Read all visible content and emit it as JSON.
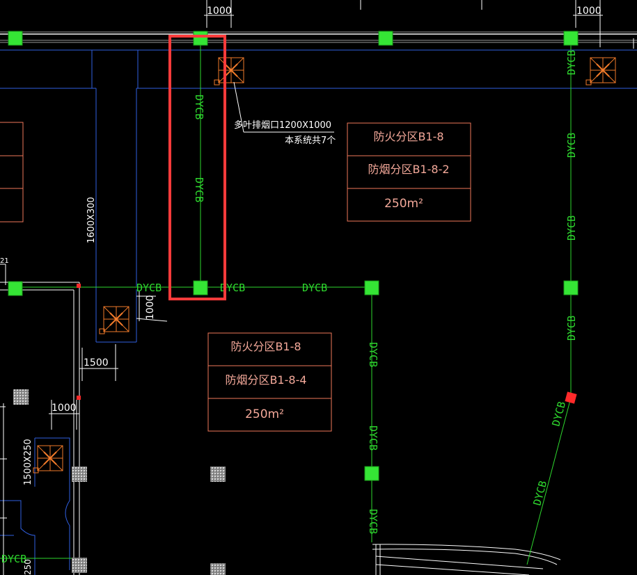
{
  "colors": {
    "background": "#000000",
    "duct_line": "#2ed82e",
    "node_fill": "#35e535",
    "duct_blue": "#2f5fe0",
    "zone_box": "#f0785a",
    "dimension": "#ffffff",
    "highlight": "#ff3b3b",
    "gray_node": "#bdbdbd"
  },
  "duct_tag": "DYCB",
  "dimensions": {
    "top_left": "1000",
    "top_right": "1000",
    "vertical_1000": "1000",
    "w1500": "1500",
    "w1000_lower": "1000",
    "duct_1600x300": "1600X300",
    "duct_1500x250": "1500X250",
    "left_partial": "21",
    "bottom_left_partial": "250"
  },
  "smoke_outlet_note": {
    "line1": "多叶排烟口1200X1000",
    "line2": "本系统共7个"
  },
  "zone_boxes": [
    {
      "fire_zone": "防火分区B1-8",
      "smoke_zone": "防烟分区B1-8-2",
      "area": "250m²"
    },
    {
      "fire_zone": "防火分区B1-8",
      "smoke_zone": "防烟分区B1-8-4",
      "area": "250m²"
    }
  ],
  "selection": {
    "icon": "highlight-rectangle"
  }
}
